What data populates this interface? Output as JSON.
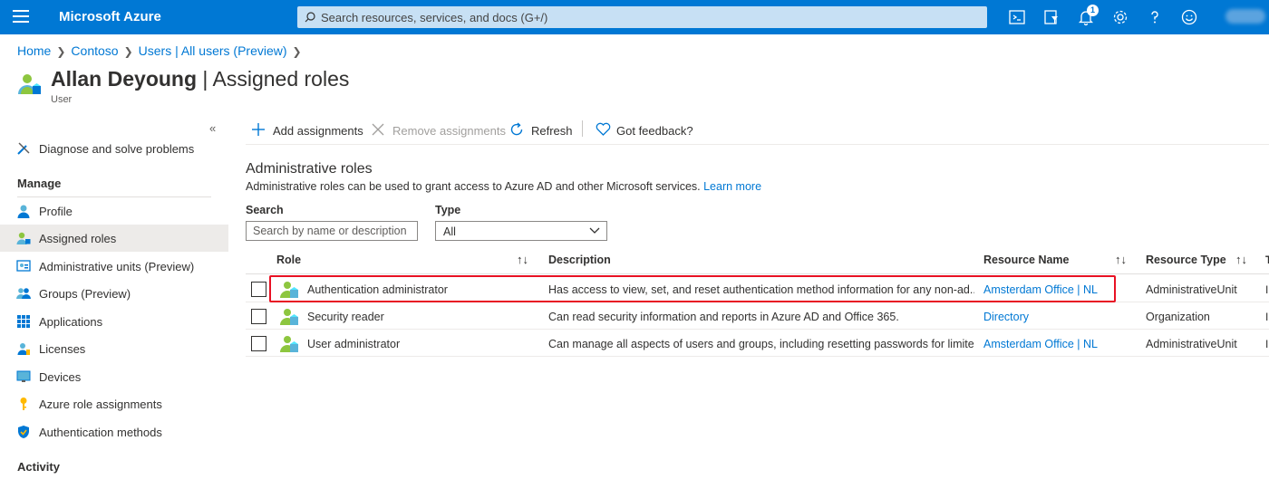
{
  "topbar": {
    "brand": "Microsoft Azure",
    "search_placeholder": "Search resources, services, and docs (G+/)",
    "notification_count": "1",
    "accent": "#0078d4"
  },
  "breadcrumb": [
    "Home",
    "Contoso",
    "Users | All users (Preview)"
  ],
  "page": {
    "title_name": "Allan Deyoung",
    "title_section": "| Assigned roles",
    "subtitle": "User"
  },
  "sidebar": {
    "collapse_glyph": "«",
    "top_item": "Diagnose and solve problems",
    "manage_header": "Manage",
    "items": [
      "Profile",
      "Assigned roles",
      "Administrative units (Preview)",
      "Groups (Preview)",
      "Applications",
      "Licenses",
      "Devices",
      "Azure role assignments",
      "Authentication methods"
    ],
    "active": "Assigned roles",
    "activity_header": "Activity"
  },
  "toolbar": {
    "add": "Add assignments",
    "remove": "Remove assignments",
    "refresh": "Refresh",
    "feedback": "Got feedback?"
  },
  "section": {
    "title": "Administrative roles",
    "description": "Administrative roles can be used to grant access to Azure AD and other Microsoft services.",
    "learn_more": "Learn more"
  },
  "filters": {
    "search_label": "Search",
    "search_placeholder": "Search by name or description",
    "type_label": "Type",
    "type_value": "All"
  },
  "table": {
    "headers": [
      "Role",
      "Description",
      "Resource Name",
      "Resource Type"
    ],
    "sort_glyph": "↑↓",
    "rows": [
      {
        "role": "Authentication administrator",
        "description": "Has access to view, set, and reset authentication method information for any non-ad...",
        "resource_name": "Amsterdam Office | NL",
        "resource_type": "AdministrativeUnit"
      },
      {
        "role": "Security reader",
        "description": "Can read security information and reports in Azure AD and Office 365.",
        "resource_name": "Directory",
        "resource_type": "Organization"
      },
      {
        "role": "User administrator",
        "description": "Can manage all aspects of users and groups, including resetting passwords for limite...",
        "resource_name": "Amsterdam Office | NL",
        "resource_type": "AdministrativeUnit"
      }
    ],
    "highlight_color": "#e81123"
  }
}
